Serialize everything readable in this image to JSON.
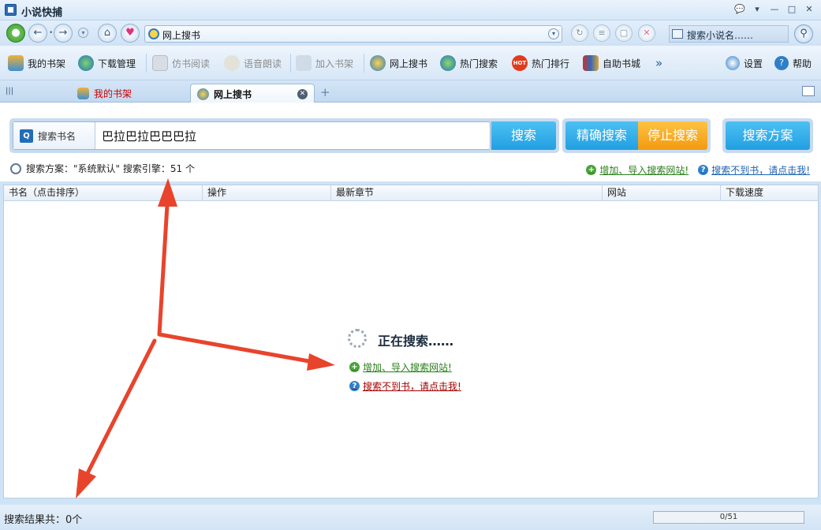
{
  "app": {
    "title": "小说快捕",
    "window_buttons": [
      "💬",
      "▾",
      "—",
      "□",
      "✕"
    ]
  },
  "addressbar": {
    "url_text": "网上搜书",
    "search_placeholder": "搜索小说名……"
  },
  "toolbar": {
    "items": [
      {
        "label": "我的书架",
        "icon": "bookshelf-icon",
        "enabled": true
      },
      {
        "label": "下载管理",
        "icon": "download-globe-icon",
        "enabled": true
      },
      {
        "label": "仿书阅读",
        "icon": "book-icon",
        "enabled": false
      },
      {
        "label": "语音朗读",
        "icon": "microphone-icon",
        "enabled": false
      },
      {
        "label": "加入书架",
        "icon": "add-book-icon",
        "enabled": false
      },
      {
        "label": "网上搜书",
        "icon": "web-search-icon",
        "enabled": true
      },
      {
        "label": "热门搜索",
        "icon": "globe-icon",
        "enabled": true
      },
      {
        "label": "热门排行",
        "icon": "hot-icon",
        "enabled": true
      },
      {
        "label": "自助书城",
        "icon": "books-icon",
        "enabled": true
      }
    ],
    "more": "»",
    "settings_label": "设置",
    "help_label": "帮助"
  },
  "tabs": {
    "inactive_label": "我的书架",
    "active_label": "网上搜书"
  },
  "search": {
    "field_label": "搜索书名",
    "query": "巴拉巴拉巴巴巴拉",
    "search_button": "搜索",
    "exact_button": "精确搜索",
    "stop_button": "停止搜索",
    "scheme_button": "搜索方案",
    "scheme_line": "搜索方案：\"系统默认\"  搜索引擎：51 个",
    "add_site_link": "增加、导入搜索网站!",
    "not_found_link": "搜索不到书，请点击我!"
  },
  "table": {
    "headers": [
      "书名（点击排序）",
      "操作",
      "最新章节",
      "网站",
      "下载速度"
    ]
  },
  "status": {
    "searching": "正在搜索……",
    "add_site_link": "增加、导入搜索网站!",
    "not_found_link": "搜索不到书，请点击我!"
  },
  "statusbar": {
    "result_count": "搜索结果共：0个",
    "progress": "0/51",
    "progress_fraction": 0
  },
  "colors": {
    "accent_blue": "#229fe2",
    "stop_orange": "#f19a10",
    "arrow_red": "#e8442c"
  }
}
